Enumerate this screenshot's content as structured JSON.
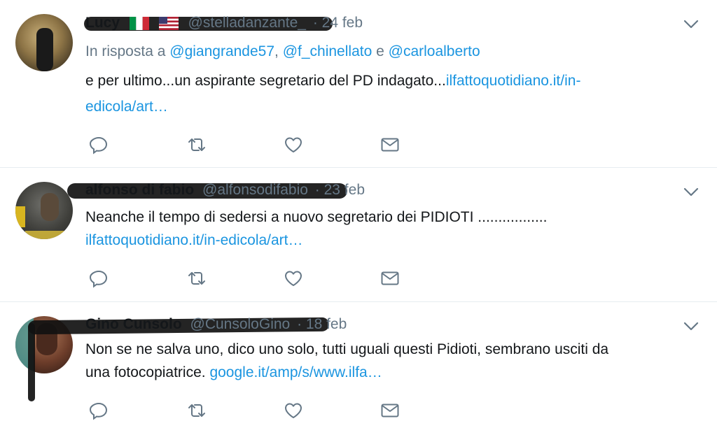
{
  "tweets": [
    {
      "name": "Lucy",
      "handle": "@stelladanzante_",
      "date": "24 feb",
      "reply_prefix": "In risposta a",
      "reply_users": [
        "@giangrande57",
        "@f_chinellato",
        "@carloalberto"
      ],
      "reply_sep1": ", ",
      "reply_sep2": " e ",
      "text": "e per ultimo...un aspirante segretario del PD indagato...",
      "link_line1": "ilfattoquotidiano.it/in-",
      "link_line2": "edicola/art…"
    },
    {
      "name": "alfonso di fabio",
      "handle": "@alfonsodifabio",
      "date": "23 feb",
      "text": "Neanche il tempo di sedersi a nuovo segretario dei PIDIOTI .................",
      "link": "ilfattoquotidiano.it/in-edicola/art…"
    },
    {
      "name": "Gino Cunsolo",
      "handle": "@CunsoloGino",
      "date": "18 feb",
      "text_line1": "Non se ne salva uno, dico uno solo, tutti uguali questi Pidioti, sembrano usciti da",
      "text_line2": "una fotocopiatrice. ",
      "link": "google.it/amp/s/www.ilfa…"
    }
  ],
  "icons": [
    "reply-icon",
    "retweet-icon",
    "like-icon",
    "dm-icon",
    "chevron-down-icon",
    "italy-flag-icon",
    "usa-flag-icon"
  ],
  "colors": {
    "link": "#1b95e0",
    "muted": "#657786",
    "text": "#14171a",
    "divider": "#e6ecf0"
  }
}
